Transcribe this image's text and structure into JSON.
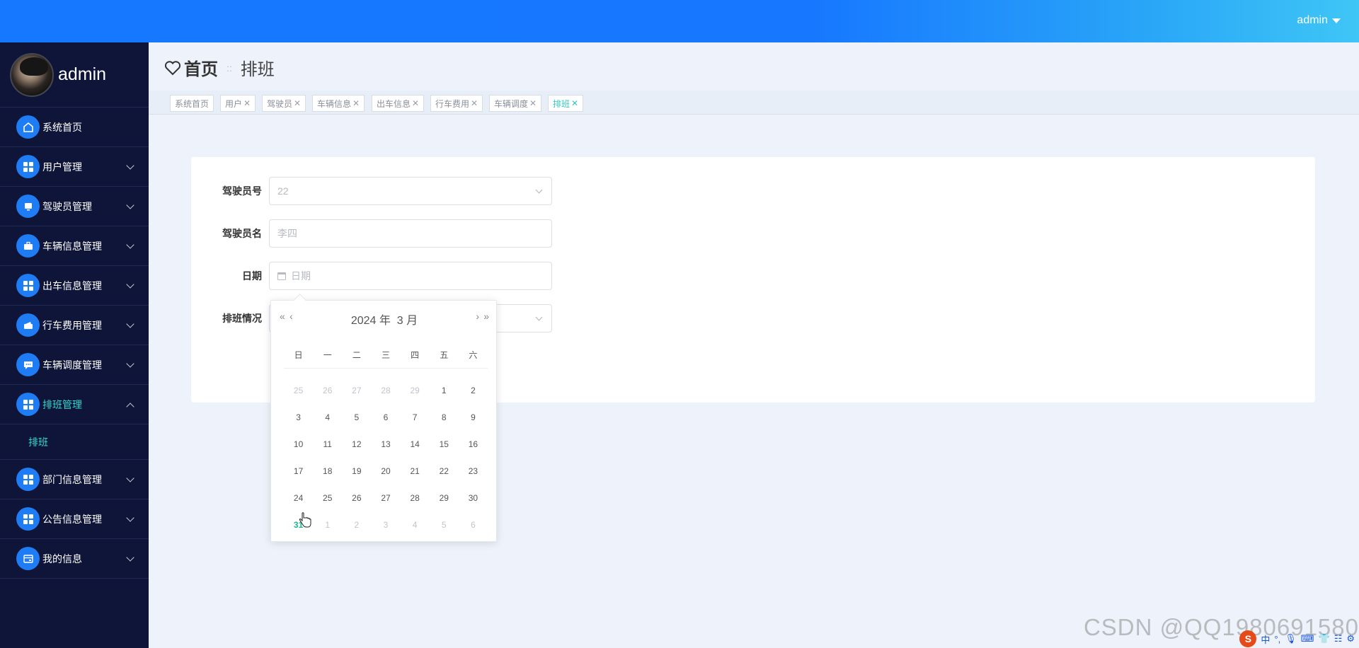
{
  "topbar": {
    "user": "admin"
  },
  "sidebar": {
    "profile_name": "admin",
    "items": [
      {
        "label": "系统首页",
        "icon": "home-icon"
      },
      {
        "label": "用户管理",
        "icon": "grid-icon"
      },
      {
        "label": "驾驶员管理",
        "icon": "monitor-icon"
      },
      {
        "label": "车辆信息管理",
        "icon": "briefcase-icon"
      },
      {
        "label": "出车信息管理",
        "icon": "grid-icon"
      },
      {
        "label": "行车费用管理",
        "icon": "wallet-icon"
      },
      {
        "label": "车辆调度管理",
        "icon": "chat-icon"
      },
      {
        "label": "排班管理",
        "icon": "grid-icon"
      },
      {
        "label": "部门信息管理",
        "icon": "grid-icon"
      },
      {
        "label": "公告信息管理",
        "icon": "grid-icon"
      },
      {
        "label": "我的信息",
        "icon": "card-icon"
      }
    ],
    "sub_item": "排班"
  },
  "breadcrumb": {
    "home": "首页",
    "separator": "::",
    "current": "排班"
  },
  "tabs": [
    "系统首页",
    "用户",
    "驾驶员",
    "车辆信息",
    "出车信息",
    "行车费用",
    "车辆调度",
    "排班"
  ],
  "tab_close": "✕",
  "form": {
    "driver_no_label": "驾驶员号",
    "driver_no_value": "22",
    "driver_name_label": "驾驶员名",
    "driver_name_placeholder": "李四",
    "date_label": "日期",
    "date_placeholder": "日期",
    "schedule_label": "排班情况"
  },
  "datepicker": {
    "year": "2024 年",
    "month": "3 月",
    "weekdays": [
      "日",
      "一",
      "二",
      "三",
      "四",
      "五",
      "六"
    ],
    "rows": [
      [
        "25",
        "26",
        "27",
        "28",
        "29",
        "1",
        "2"
      ],
      [
        "3",
        "4",
        "5",
        "6",
        "7",
        "8",
        "9"
      ],
      [
        "10",
        "11",
        "12",
        "13",
        "14",
        "15",
        "16"
      ],
      [
        "17",
        "18",
        "19",
        "20",
        "21",
        "22",
        "23"
      ],
      [
        "24",
        "25",
        "26",
        "27",
        "28",
        "29",
        "30"
      ],
      [
        "31",
        "1",
        "2",
        "3",
        "4",
        "5",
        "6"
      ]
    ]
  },
  "watermark": "CSDN @QQ1980691580",
  "ime": {
    "lang": "中"
  },
  "colors": {
    "topbar": "#1677ff",
    "sidebar": "#0f1538",
    "accent": "#2fd6d0",
    "today": "#1fb68f"
  }
}
